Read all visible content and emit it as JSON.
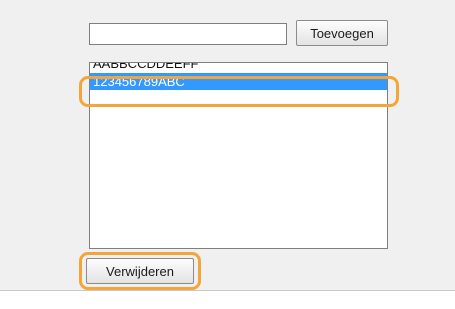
{
  "form": {
    "input_value": "",
    "add_button_label": "Toevoegen",
    "remove_button_label": "Verwijderen"
  },
  "list": {
    "items": [
      {
        "label": "AABBCCDDEEFF",
        "selected": false
      },
      {
        "label": "123456789ABC",
        "selected": true
      }
    ]
  },
  "colors": {
    "selection": "#3399ff",
    "highlight": "#f4a53a"
  }
}
